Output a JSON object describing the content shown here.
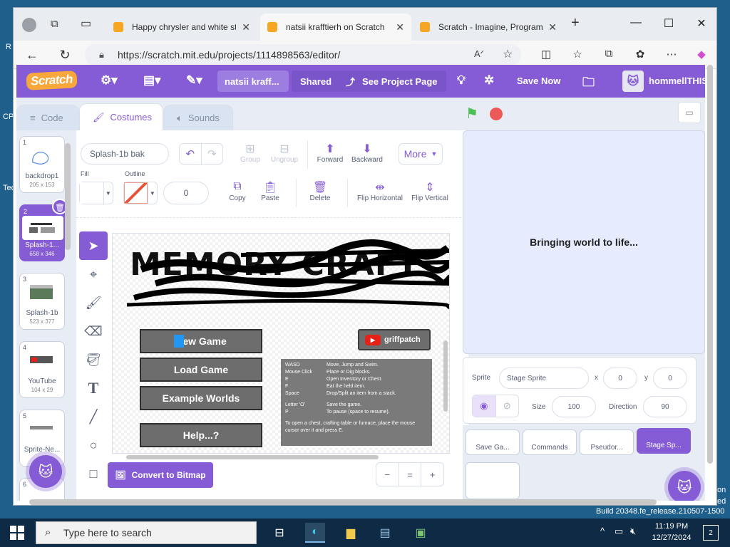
{
  "desktop": {
    "frag_r": "R",
    "frag_cp": "CP",
    "frag_tec": "Tec",
    "frag_on": "on",
    "frag_ed": "ed"
  },
  "browser": {
    "tabs": [
      {
        "label": "Happy chrysler and white stu",
        "active": false
      },
      {
        "label": "natsii krafftierh on Scratch",
        "active": true
      },
      {
        "label": "Scratch - Imagine, Program,",
        "active": false
      }
    ],
    "new_tab_label": "+",
    "url": "https://scratch.mit.edu/projects/1114898563/editor/"
  },
  "scratch": {
    "menu": {
      "logo_text": "Scratch",
      "project_title": "natsii kraff...",
      "shared_label": "Shared",
      "see_project_label": "See Project Page",
      "save_now_label": "Save Now",
      "username": "hommellTHIS"
    },
    "editor_tabs": {
      "code": "Code",
      "costumes": "Costumes",
      "sounds": "Sounds"
    },
    "costumes": [
      {
        "num": "1",
        "name": "backdrop1",
        "size": "205 x 153"
      },
      {
        "num": "2",
        "name": "Splash-1...",
        "size": "658 x 346"
      },
      {
        "num": "3",
        "name": "Splash-1b",
        "size": "523 x 377"
      },
      {
        "num": "4",
        "name": "YouTube",
        "size": "104 x 29"
      },
      {
        "num": "5",
        "name": "Sprite-Ne...",
        "size": ""
      },
      {
        "num": "6",
        "name": "",
        "size": ""
      }
    ],
    "paint": {
      "costume_name": "Splash-1b bak",
      "group_label": "Group",
      "ungroup_label": "Ungroup",
      "forward_label": "Forward",
      "backward_label": "Backward",
      "more_label": "More",
      "fill_label": "Fill",
      "outline_label": "Outline",
      "outline_width": "0",
      "copy_label": "Copy",
      "paste_label": "Paste",
      "delete_label": "Delete",
      "flip_h_label": "Flip Horizontal",
      "flip_v_label": "Flip Vertical",
      "convert_label": "Convert to Bitmap",
      "zoom_out": "−",
      "zoom_reset": "=",
      "zoom_in": "+"
    },
    "canvas": {
      "title_text": "MEMORY CRAFT",
      "buttons": [
        "New Game",
        "Load Game",
        "Example Worlds",
        "Help...?"
      ],
      "griffpatch_label": "griffpatch",
      "youtube_glyph": "▶",
      "help_rows": [
        {
          "key": "WASD",
          "val": "Move, Jump and Swim."
        },
        {
          "key": "Mouse Click",
          "val": "Place or Dig blocks."
        },
        {
          "key": "E",
          "val": "Open Inventory or Chest."
        },
        {
          "key": "F",
          "val": "Eat the held item."
        },
        {
          "key": "Space",
          "val": "Drop/Split an item from a stack."
        },
        {
          "key": "Letter 'O'",
          "val": "Save the game."
        },
        {
          "key": "P",
          "val": "To pause (space to resume)."
        }
      ],
      "help_footer": "To open a chest, crafting table or furnace, place the mouse cursor over it and press E."
    },
    "stage": {
      "loading_text": "Bringing world to life..."
    },
    "sprite_info": {
      "sprite_label": "Sprite",
      "sprite_name": "Stage Sprite",
      "x_label": "x",
      "x_value": "0",
      "y_label": "y",
      "y_value": "0",
      "size_label": "Size",
      "size_value": "100",
      "direction_label": "Direction",
      "direction_value": "90"
    },
    "sprites": [
      "Save Ga...",
      "Commands",
      "Pseudor...",
      "Stage Sp..."
    ]
  },
  "status": {
    "build": "Build 20348.fe_release.210507-1500"
  },
  "taskbar": {
    "search_placeholder": "Type here to search",
    "time": "11:19 PM",
    "date": "12/27/2024",
    "notifications": "2"
  },
  "colors": {
    "scratch_purple": "#855cd6",
    "desktop_blue": "#1f5f8b",
    "taskbar": "#0f2a44"
  }
}
